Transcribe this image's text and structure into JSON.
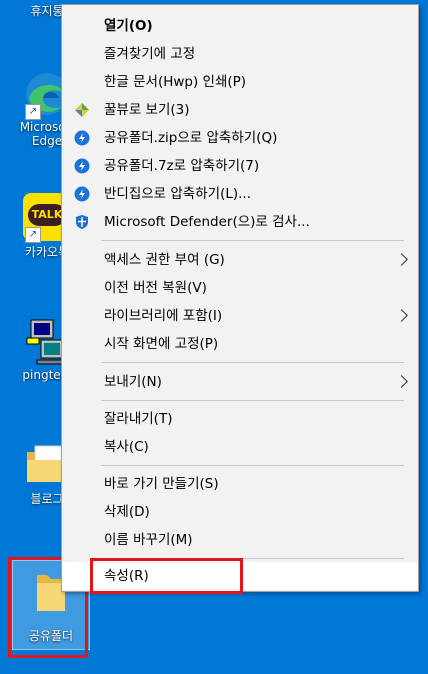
{
  "desktop": {
    "icons": [
      {
        "name": "recycle-bin",
        "label": "휴지통"
      },
      {
        "name": "edge",
        "label": "Microsoft Edge"
      },
      {
        "name": "kakaotalk",
        "label": "카카오톡",
        "badge": "TALK"
      },
      {
        "name": "pingtest",
        "label": "pingtest"
      },
      {
        "name": "blog",
        "label": "블로그"
      },
      {
        "name": "shared-folder",
        "label": "공유폴더"
      }
    ]
  },
  "menu": {
    "items": [
      {
        "label": "열기(O)",
        "bold": true
      },
      {
        "label": "즐겨찾기에 고정"
      },
      {
        "label": "한글 문서(Hwp) 인쇄(P)"
      },
      {
        "label": "꿀뷰로 보기(3)",
        "icon": "honeyview-icon"
      },
      {
        "label": "공유폴더.zip으로 압축하기(Q)",
        "icon": "bandizip-icon"
      },
      {
        "label": "공유폴더.7z로 압축하기(7)",
        "icon": "bandizip-icon"
      },
      {
        "label": "반디집으로 압축하기(L)...",
        "icon": "bandizip-icon"
      },
      {
        "label": "Microsoft Defender(으)로 검사...",
        "icon": "defender-shield-icon"
      },
      {
        "label": "액세스 권한 부여 (G)",
        "submenu": true
      },
      {
        "label": "이전 버전 복원(V)"
      },
      {
        "label": "라이브러리에 포함(I)",
        "submenu": true
      },
      {
        "label": "시작 화면에 고정(P)"
      },
      {
        "label": "보내기(N)",
        "submenu": true
      },
      {
        "label": "잘라내기(T)"
      },
      {
        "label": "복사(C)"
      },
      {
        "label": "바로 가기 만들기(S)"
      },
      {
        "label": "삭제(D)"
      },
      {
        "label": "이름 바꾸기(M)"
      },
      {
        "label": "속성(R)",
        "highlighted": true
      }
    ]
  },
  "colors": {
    "desktop_bg": "#0078d7",
    "highlight_border": "#e1161b",
    "menu_bg": "#f2f2f2"
  }
}
